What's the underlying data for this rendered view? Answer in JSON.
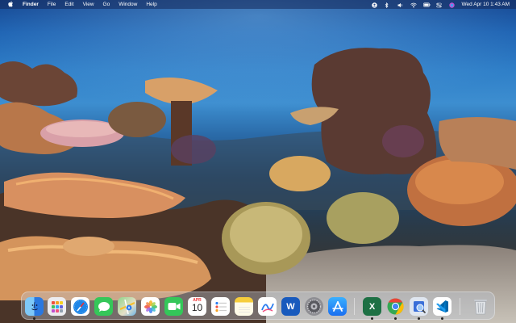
{
  "menubar": {
    "apple_icon": "apple-icon",
    "app_name": "Finder",
    "menus": [
      "File",
      "Edit",
      "View",
      "Go",
      "Window",
      "Help"
    ],
    "status_icons": [
      "user-icon",
      "bluetooth-icon",
      "audio-icon",
      "wifi-icon",
      "battery-icon",
      "control-center-icon",
      "siri-icon"
    ],
    "clock": "Wed Apr 10  1:43 AM"
  },
  "dock": {
    "apps": [
      {
        "name": "Finder",
        "icon": "finder-icon",
        "color": "#3a8ee8",
        "running": true
      },
      {
        "name": "Launchpad",
        "icon": "launchpad-icon",
        "color": "#e9e9ee",
        "running": false
      },
      {
        "name": "Safari",
        "icon": "safari-icon",
        "color": "#1e86e8",
        "running": false
      },
      {
        "name": "Messages",
        "icon": "messages-icon",
        "color": "#35c759",
        "running": false
      },
      {
        "name": "Maps",
        "icon": "maps-icon",
        "color": "#5bbf6a",
        "running": false
      },
      {
        "name": "Photos",
        "icon": "photos-icon",
        "color": "#ffffff",
        "running": false
      },
      {
        "name": "FaceTime",
        "icon": "facetime-icon",
        "color": "#34c759",
        "running": false
      },
      {
        "name": "Calendar",
        "icon": "calendar-icon",
        "color": "#ffffff",
        "running": false,
        "month": "APR",
        "day": "10"
      },
      {
        "name": "Reminders",
        "icon": "reminders-icon",
        "color": "#ffffff",
        "running": false
      },
      {
        "name": "Notes",
        "icon": "notes-icon",
        "color": "#fff6c8",
        "running": false
      },
      {
        "name": "Freeform",
        "icon": "freeform-icon",
        "color": "#ffffff",
        "running": false
      },
      {
        "name": "Microsoft Word",
        "icon": "word-icon",
        "color": "#185abd",
        "running": false,
        "glyph": "W"
      },
      {
        "name": "System Settings",
        "icon": "settings-icon",
        "color": "#8e8e93",
        "running": false
      },
      {
        "name": "App Store",
        "icon": "app-store-icon",
        "color": "#1c8ef9",
        "running": false
      }
    ],
    "recent_apps": [
      {
        "name": "Microsoft Excel",
        "icon": "excel-icon",
        "color": "#1d7044",
        "running": true,
        "glyph": "X"
      },
      {
        "name": "Google Chrome",
        "icon": "chrome-icon",
        "color": "#ffffff",
        "running": true
      },
      {
        "name": "Preview",
        "icon": "preview-icon",
        "color": "#3a6fd8",
        "running": true
      },
      {
        "name": "Visual Studio Code",
        "icon": "vscode-icon",
        "color": "#ffffff",
        "running": true
      }
    ],
    "trash": {
      "name": "Trash",
      "icon": "trash-icon"
    }
  }
}
